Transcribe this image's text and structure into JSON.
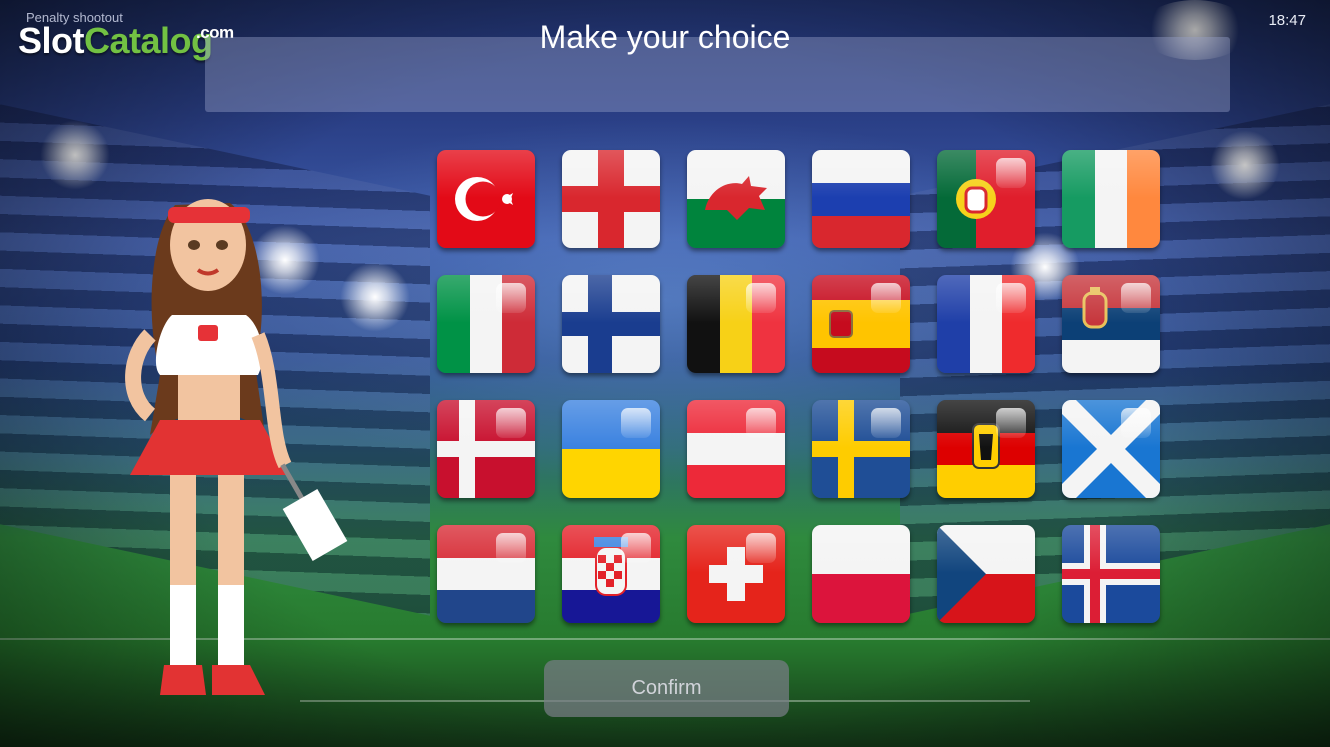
{
  "app": {
    "title": "Penalty shootout",
    "time": "18:47"
  },
  "watermark": {
    "part1": "Slot",
    "part2": "Catalog",
    "domain": ".com"
  },
  "header": {
    "title": "Make your choice"
  },
  "flags": [
    "turkey-flag",
    "england-flag",
    "wales-flag",
    "russia-flag",
    "portugal-flag",
    "ireland-flag",
    "italy-flag",
    "finland-flag",
    "belgium-flag",
    "spain-flag",
    "france-flag",
    "serbia-flag",
    "denmark-flag",
    "ukraine-flag",
    "austria-flag",
    "sweden-flag",
    "germany-flag",
    "scotland-flag",
    "netherlands-flag",
    "croatia-flag",
    "switzerland-flag",
    "poland-flag",
    "czech-republic-flag",
    "iceland-flag"
  ],
  "footer": {
    "confirm_label": "Confirm"
  }
}
